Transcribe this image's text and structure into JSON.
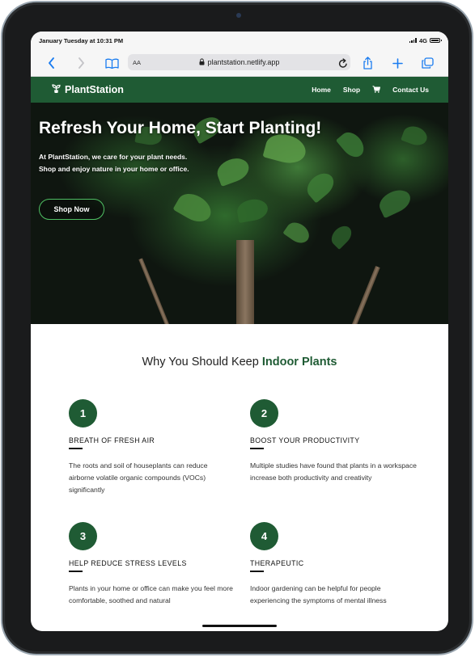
{
  "status_bar": {
    "time": "January Tuesday at 10:31 PM",
    "network": "4G"
  },
  "browser": {
    "text_size_label": "AA",
    "url": "plantstation.netlify.app",
    "icons": [
      "back-icon",
      "forward-icon",
      "bookmarks-icon",
      "lock-icon",
      "reload-icon",
      "share-icon",
      "new-tab-icon",
      "tabs-icon"
    ]
  },
  "site_nav": {
    "brand": "PlantStation",
    "links": [
      "Home",
      "Shop",
      "Contact Us"
    ],
    "cart_icon": "cart-icon"
  },
  "hero": {
    "title": "Refresh Your Home, Start Planting!",
    "description": "At PlantStation, we care for your plant needs. Shop and enjoy nature in your home or office.",
    "cta": "Shop Now"
  },
  "why": {
    "heading_prefix": "Why You Should Keep",
    "heading_accent": "Indoor Plants",
    "features": [
      {
        "number": "1",
        "title": "BREATH OF FRESH AIR",
        "text": "The roots and soil of houseplants can reduce airborne volatile organic compounds (VOCs) significantly"
      },
      {
        "number": "2",
        "title": "BOOST YOUR PRODUCTIVITY",
        "text": "Multiple studies have found that plants in a workspace increase both productivity and creativity"
      },
      {
        "number": "3",
        "title": "HELP REDUCE STRESS LEVELS",
        "text": "Plants in your home or office can make you feel more comfortable, soothed and natural"
      },
      {
        "number": "4",
        "title": "THERAPEUTIC",
        "text": "Indoor gardening can be helpful for people experiencing the symptoms of mental illness"
      }
    ]
  },
  "colors": {
    "brand_green": "#1f5b34",
    "browser_accent": "#1a7cf0"
  }
}
